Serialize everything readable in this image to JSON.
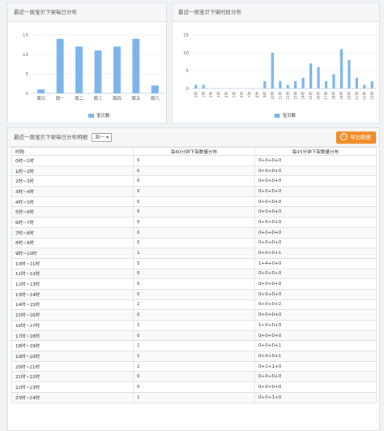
{
  "panel_daily": {
    "title": "最近一周宝贝下架每日分布",
    "legend": "宝贝数",
    "chart_data": {
      "type": "bar",
      "categories": [
        "周日",
        "周一",
        "周二",
        "周三",
        "周四",
        "周五",
        "周六"
      ],
      "values": [
        1,
        14,
        12,
        11,
        12,
        14,
        2
      ],
      "ylim": [
        0,
        15
      ],
      "yticks": [
        0,
        5,
        10,
        15
      ],
      "series": [
        {
          "name": "宝贝数",
          "values": [
            1,
            14,
            12,
            11,
            12,
            14,
            2
          ]
        }
      ],
      "bar_color": "#7cb5ec",
      "legend_position": "bottom-center",
      "grid": true
    }
  },
  "panel_hourly": {
    "title": "最近一周宝贝下架时段分布",
    "legend": "宝贝数",
    "chart_data": {
      "type": "bar",
      "categories": [
        "0时",
        "1时",
        "2时",
        "3时",
        "4时",
        "5时",
        "6时",
        "7时",
        "8时",
        "9时",
        "10时",
        "11时",
        "12时",
        "13时",
        "14时",
        "15时",
        "16时",
        "17时",
        "18时",
        "19时",
        "20时",
        "21时",
        "22时",
        "23时"
      ],
      "values": [
        1,
        1,
        0,
        0,
        0,
        0,
        0,
        0,
        0,
        2,
        10,
        2,
        1,
        2,
        3,
        7,
        6,
        2,
        4,
        11,
        8,
        3,
        1,
        2
      ],
      "ylim": [
        0,
        15
      ],
      "yticks": [
        0,
        5,
        10,
        15
      ],
      "series": [
        {
          "name": "宝贝数",
          "values": [
            1,
            1,
            0,
            0,
            0,
            0,
            0,
            0,
            0,
            2,
            10,
            2,
            1,
            2,
            3,
            7,
            6,
            2,
            4,
            11,
            8,
            3,
            1,
            2
          ]
        }
      ],
      "bar_color": "#7cb5ec",
      "legend_position": "bottom-center",
      "grid": true
    }
  },
  "detail": {
    "title": "最近一周宝贝下架每日分布明细",
    "day_select": "周一",
    "export_label": "导出数据",
    "export_icon": "download-icon",
    "accent_color": "#f28c28",
    "columns": [
      "时段",
      "每60分钟下架数量分布",
      "每15分钟下架数量分布"
    ],
    "rows": [
      [
        "0时~1时",
        "0",
        "0+0+0+0"
      ],
      [
        "1时~2时",
        "0",
        "0+0+0+0"
      ],
      [
        "2时~3时",
        "0",
        "0+0+0+0"
      ],
      [
        "3时~4时",
        "0",
        "0+0+0+0"
      ],
      [
        "4时~5时",
        "0",
        "0+0+0+0"
      ],
      [
        "5时~6时",
        "0",
        "0+0+0+0"
      ],
      [
        "6时~7时",
        "0",
        "0+0+0+0"
      ],
      [
        "7时~8时",
        "0",
        "0+0+0+0"
      ],
      [
        "8时~9时",
        "0",
        "0+0+0+0"
      ],
      [
        "9时~10时",
        "1",
        "0+0+0+1"
      ],
      [
        "10时~11时",
        "5",
        "1+4+0+0"
      ],
      [
        "11时~12时",
        "0",
        "0+0+0+0"
      ],
      [
        "12时~13时",
        "0",
        "0+0+0+0"
      ],
      [
        "13时~14时",
        "0",
        "0+0+0+0"
      ],
      [
        "14时~15时",
        "2",
        "0+0+0+2"
      ],
      [
        "15时~16时",
        "0",
        "0+0+0+0"
      ],
      [
        "16时~17时",
        "1",
        "1+0+0+0"
      ],
      [
        "17时~18时",
        "0",
        "0+0+0+0"
      ],
      [
        "18时~19时",
        "1",
        "0+0+0+1"
      ],
      [
        "19时~20时",
        "1",
        "0+0+0+1"
      ],
      [
        "20时~21时",
        "2",
        "0+1+1+0"
      ],
      [
        "21时~22时",
        "0",
        "0+0+0+0"
      ],
      [
        "22时~23时",
        "0",
        "0+0+0+0"
      ],
      [
        "23时~24时",
        "1",
        "0+0+1+0"
      ]
    ]
  }
}
